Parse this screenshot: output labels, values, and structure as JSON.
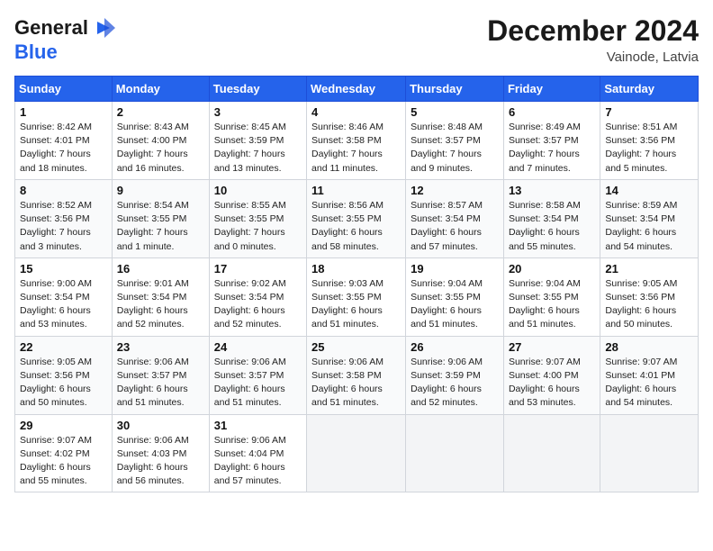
{
  "logo": {
    "line1": "General",
    "line2": "Blue"
  },
  "title": "December 2024",
  "location": "Vainode, Latvia",
  "days_of_week": [
    "Sunday",
    "Monday",
    "Tuesday",
    "Wednesday",
    "Thursday",
    "Friday",
    "Saturday"
  ],
  "weeks": [
    [
      {
        "day": 1,
        "rise": "8:42 AM",
        "set": "4:01 PM",
        "daylight": "7 hours and 18 minutes."
      },
      {
        "day": 2,
        "rise": "8:43 AM",
        "set": "4:00 PM",
        "daylight": "7 hours and 16 minutes."
      },
      {
        "day": 3,
        "rise": "8:45 AM",
        "set": "3:59 PM",
        "daylight": "7 hours and 13 minutes."
      },
      {
        "day": 4,
        "rise": "8:46 AM",
        "set": "3:58 PM",
        "daylight": "7 hours and 11 minutes."
      },
      {
        "day": 5,
        "rise": "8:48 AM",
        "set": "3:57 PM",
        "daylight": "7 hours and 9 minutes."
      },
      {
        "day": 6,
        "rise": "8:49 AM",
        "set": "3:57 PM",
        "daylight": "7 hours and 7 minutes."
      },
      {
        "day": 7,
        "rise": "8:51 AM",
        "set": "3:56 PM",
        "daylight": "7 hours and 5 minutes."
      }
    ],
    [
      {
        "day": 8,
        "rise": "8:52 AM",
        "set": "3:56 PM",
        "daylight": "7 hours and 3 minutes."
      },
      {
        "day": 9,
        "rise": "8:54 AM",
        "set": "3:55 PM",
        "daylight": "7 hours and 1 minute."
      },
      {
        "day": 10,
        "rise": "8:55 AM",
        "set": "3:55 PM",
        "daylight": "7 hours and 0 minutes."
      },
      {
        "day": 11,
        "rise": "8:56 AM",
        "set": "3:55 PM",
        "daylight": "6 hours and 58 minutes."
      },
      {
        "day": 12,
        "rise": "8:57 AM",
        "set": "3:54 PM",
        "daylight": "6 hours and 57 minutes."
      },
      {
        "day": 13,
        "rise": "8:58 AM",
        "set": "3:54 PM",
        "daylight": "6 hours and 55 minutes."
      },
      {
        "day": 14,
        "rise": "8:59 AM",
        "set": "3:54 PM",
        "daylight": "6 hours and 54 minutes."
      }
    ],
    [
      {
        "day": 15,
        "rise": "9:00 AM",
        "set": "3:54 PM",
        "daylight": "6 hours and 53 minutes."
      },
      {
        "day": 16,
        "rise": "9:01 AM",
        "set": "3:54 PM",
        "daylight": "6 hours and 52 minutes."
      },
      {
        "day": 17,
        "rise": "9:02 AM",
        "set": "3:54 PM",
        "daylight": "6 hours and 52 minutes."
      },
      {
        "day": 18,
        "rise": "9:03 AM",
        "set": "3:55 PM",
        "daylight": "6 hours and 51 minutes."
      },
      {
        "day": 19,
        "rise": "9:04 AM",
        "set": "3:55 PM",
        "daylight": "6 hours and 51 minutes."
      },
      {
        "day": 20,
        "rise": "9:04 AM",
        "set": "3:55 PM",
        "daylight": "6 hours and 51 minutes."
      },
      {
        "day": 21,
        "rise": "9:05 AM",
        "set": "3:56 PM",
        "daylight": "6 hours and 50 minutes."
      }
    ],
    [
      {
        "day": 22,
        "rise": "9:05 AM",
        "set": "3:56 PM",
        "daylight": "6 hours and 50 minutes."
      },
      {
        "day": 23,
        "rise": "9:06 AM",
        "set": "3:57 PM",
        "daylight": "6 hours and 51 minutes."
      },
      {
        "day": 24,
        "rise": "9:06 AM",
        "set": "3:57 PM",
        "daylight": "6 hours and 51 minutes."
      },
      {
        "day": 25,
        "rise": "9:06 AM",
        "set": "3:58 PM",
        "daylight": "6 hours and 51 minutes."
      },
      {
        "day": 26,
        "rise": "9:06 AM",
        "set": "3:59 PM",
        "daylight": "6 hours and 52 minutes."
      },
      {
        "day": 27,
        "rise": "9:07 AM",
        "set": "4:00 PM",
        "daylight": "6 hours and 53 minutes."
      },
      {
        "day": 28,
        "rise": "9:07 AM",
        "set": "4:01 PM",
        "daylight": "6 hours and 54 minutes."
      }
    ],
    [
      {
        "day": 29,
        "rise": "9:07 AM",
        "set": "4:02 PM",
        "daylight": "6 hours and 55 minutes."
      },
      {
        "day": 30,
        "rise": "9:06 AM",
        "set": "4:03 PM",
        "daylight": "6 hours and 56 minutes."
      },
      {
        "day": 31,
        "rise": "9:06 AM",
        "set": "4:04 PM",
        "daylight": "6 hours and 57 minutes."
      },
      null,
      null,
      null,
      null
    ]
  ]
}
